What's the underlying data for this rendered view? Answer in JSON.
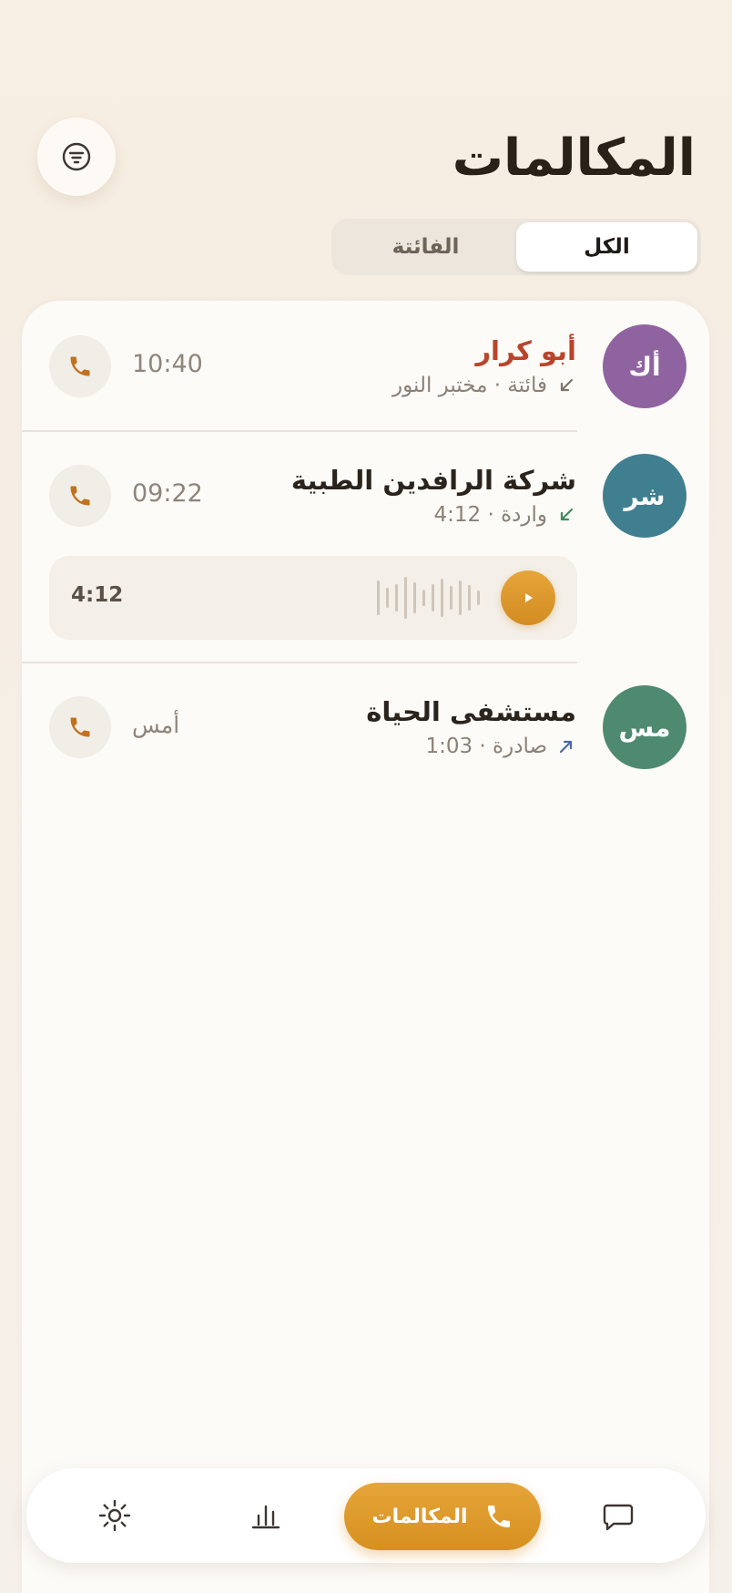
{
  "header": {
    "title": "المكالمات",
    "filter_icon": "filter-icon"
  },
  "tabs": [
    {
      "label": "الكل",
      "active": true
    },
    {
      "label": "الفائتة",
      "active": false
    }
  ],
  "calls": [
    {
      "initials": "أك",
      "name": "أبو كرار",
      "status": "فائتة · مختبر النور",
      "direction": "missed",
      "time": "10:40",
      "avatar_color": "#8e63a0"
    },
    {
      "initials": "شر",
      "name": "شركة الرافدين الطبية",
      "status": "واردة · 4:12",
      "direction": "incoming",
      "time": "09:22",
      "avatar_color": "#3f7f90",
      "voice_note": {
        "duration": "4:12"
      }
    },
    {
      "initials": "مس",
      "name": "مستشفى الحياة",
      "status": "صادرة · 1:03",
      "direction": "outgoing",
      "time": "أمس",
      "avatar_color": "#4e8a6f"
    }
  ],
  "bottom_nav": {
    "active_label": "المكالمات",
    "items": [
      "chat-icon",
      "phone-icon",
      "chart-icon",
      "sun-icon"
    ]
  },
  "colors": {
    "accent": "#d89324",
    "missed": "#b8452b",
    "incoming_arrow": "#3f8a5e",
    "outgoing_arrow": "#4a6aa8"
  }
}
